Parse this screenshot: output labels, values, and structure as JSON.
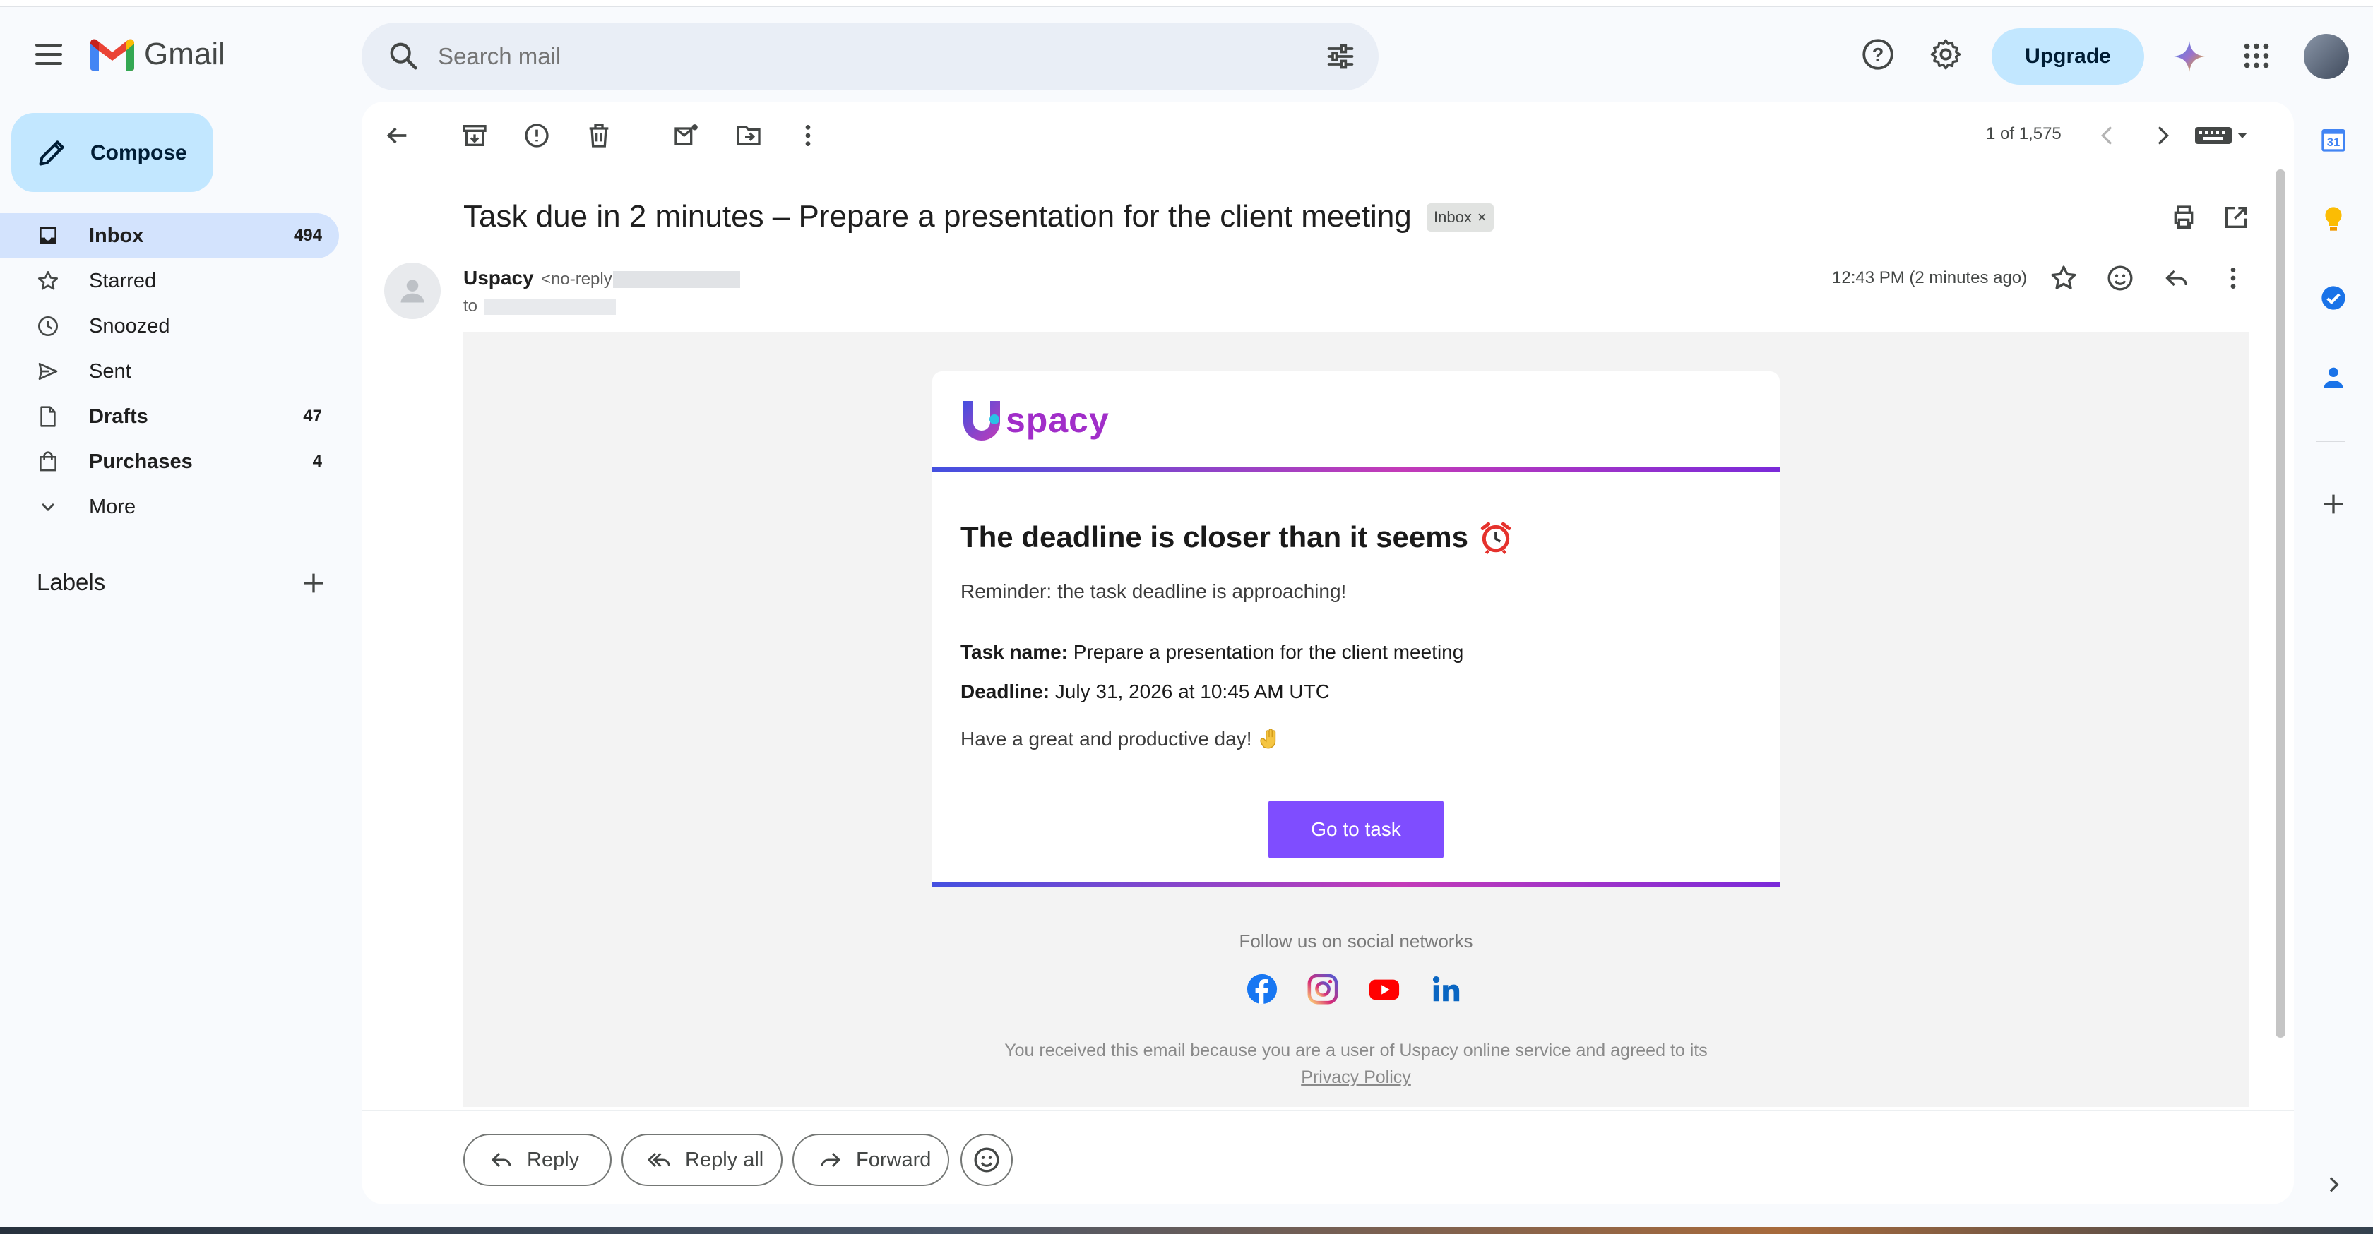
{
  "app": {
    "name": "Gmail"
  },
  "search": {
    "placeholder": "Search mail"
  },
  "header": {
    "upgrade_label": "Upgrade"
  },
  "compose_label": "Compose",
  "nav": [
    {
      "label": "Inbox",
      "count": "494"
    },
    {
      "label": "Starred",
      "count": ""
    },
    {
      "label": "Snoozed",
      "count": ""
    },
    {
      "label": "Sent",
      "count": ""
    },
    {
      "label": "Drafts",
      "count": "47"
    },
    {
      "label": "Purchases",
      "count": "4"
    },
    {
      "label": "More",
      "count": ""
    }
  ],
  "labels_title": "Labels",
  "toolbar": {
    "pager": "1 of 1,575"
  },
  "email": {
    "subject": "Task due in 2 minutes – Prepare a presentation for the client meeting",
    "label_chip": "Inbox",
    "sender_name": "Uspacy",
    "sender_email": "<no-reply",
    "to_prefix": "to",
    "time": "12:43 PM (2 minutes ago)"
  },
  "body": {
    "brand": "spacy",
    "headline": "The deadline is closer than it seems",
    "reminder": "Reminder: the task deadline is approaching!",
    "task_label": "Task name:",
    "task_value": " Prepare a presentation for the client meeting",
    "deadline_label": "Deadline:",
    "deadline_value": " July 31, 2026 at 10:45 AM UTC",
    "greeting": "Have a great and productive day!",
    "cta": "Go to task",
    "follow": "Follow us on social networks",
    "footer": "You received this email because you are a user of Uspacy online service and agreed to its",
    "privacy": "Privacy Policy"
  },
  "reply_actions": {
    "reply": "Reply",
    "reply_all": "Reply all",
    "forward": "Forward"
  },
  "side_panel": {
    "calendar_day": "31"
  },
  "colors": {
    "accent": "#c2e7ff",
    "cta": "#7f4dff",
    "brand": "#a12ec9"
  }
}
